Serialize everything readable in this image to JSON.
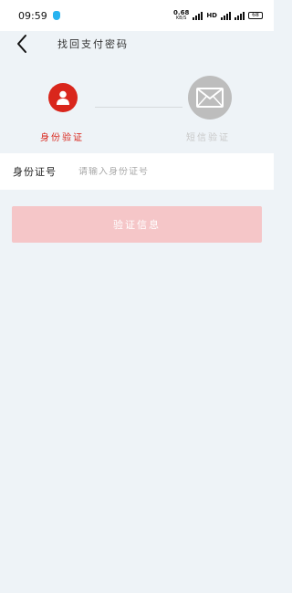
{
  "status_bar": {
    "time": "09:59",
    "net_speed": "0.68",
    "net_speed_unit": "KB/S",
    "hd_label": "HD",
    "battery": "68"
  },
  "header": {
    "title": "找回支付密码",
    "back_icon": "chevron-left-icon"
  },
  "steps": [
    {
      "label": "身份验证",
      "icon": "user-icon",
      "state": "active",
      "color": "#d9261c"
    },
    {
      "label": "短信验证",
      "icon": "mail-icon",
      "state": "inactive",
      "color": "#bdbdbd"
    }
  ],
  "form": {
    "id_label": "身份证号",
    "id_value": "",
    "id_placeholder": "请输入身份证号"
  },
  "next_button": {
    "label": "验证信息",
    "enabled": false,
    "color": "#f5c6c8"
  },
  "colors": {
    "accent": "#d9261c",
    "background": "#eef3f7"
  }
}
